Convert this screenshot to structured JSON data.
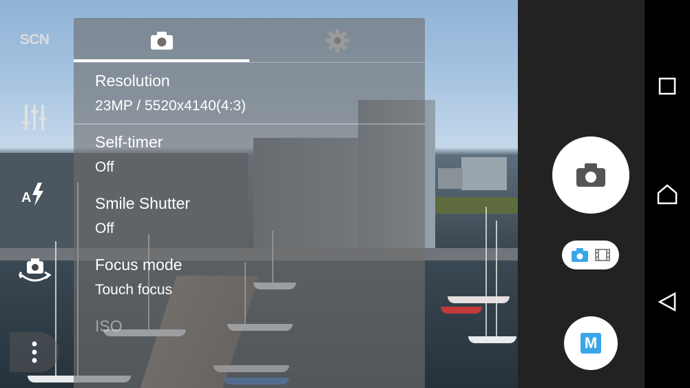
{
  "left_controls": {
    "scene_label": "SCN"
  },
  "settings_panel": {
    "tabs": [
      {
        "name": "camera",
        "icon": "camera-icon",
        "active": true
      },
      {
        "name": "settings",
        "icon": "gear-icon",
        "active": false
      }
    ],
    "items": [
      {
        "title": "Resolution",
        "value": "23MP / 5520x4140(4:3)"
      },
      {
        "title": "Self-timer",
        "value": "Off"
      },
      {
        "title": "Smile Shutter",
        "value": "Off"
      },
      {
        "title": "Focus mode",
        "value": "Touch focus"
      },
      {
        "title": "ISO",
        "value": ""
      }
    ]
  },
  "right_controls": {
    "shutter_icon": "camera-icon",
    "mode_switch": {
      "photo_icon": "camera-icon",
      "video_icon": "film-icon"
    },
    "manual_label": "M"
  },
  "nav_bar": {
    "buttons": [
      "recents-square-icon",
      "home-icon",
      "back-triangle-icon"
    ]
  },
  "colors": {
    "accent": "#3aa6e8",
    "panel_overlay": "rgba(110,110,110,0.62)",
    "control_bg": "#222222"
  }
}
